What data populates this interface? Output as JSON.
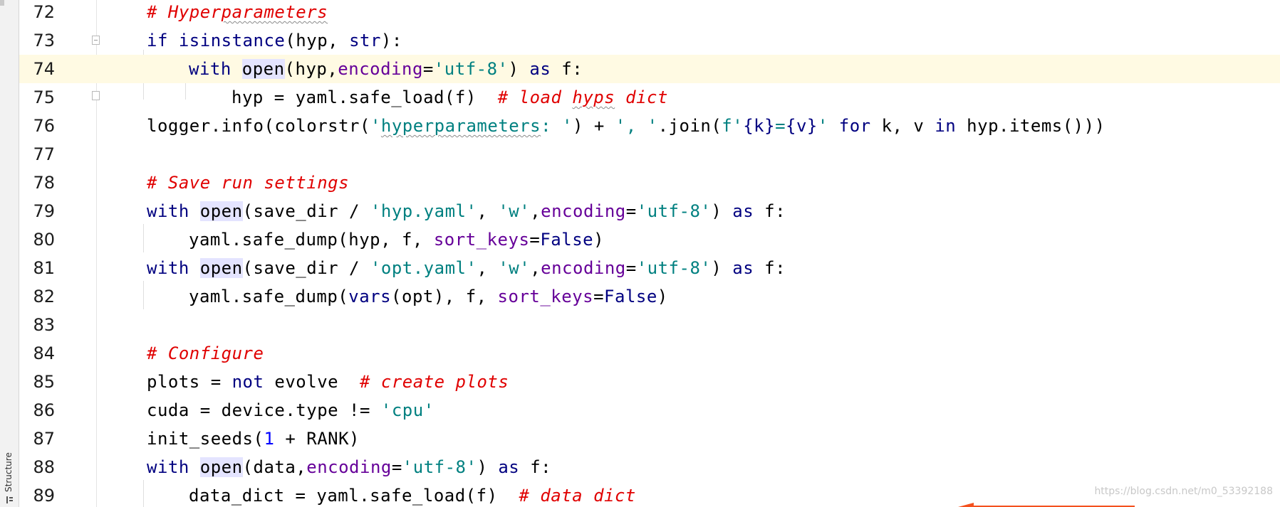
{
  "sidebar": {
    "structure_tab_label": "Structure",
    "structure_icon": "structure-icon"
  },
  "watermark": "https://blog.csdn.net/m0_53392188",
  "colors": {
    "keyword": "#000080",
    "string": "#008080",
    "comment": "#e00000",
    "param": "#660099",
    "number": "#0000ff",
    "current_line": "#fffae3",
    "identifier_highlight": "#e4e4ff",
    "annotation_arrow": "#f4511e"
  },
  "editor": {
    "current_line": "74",
    "lines": [
      {
        "num": "72"
      },
      {
        "num": "73"
      },
      {
        "num": "74"
      },
      {
        "num": "75"
      },
      {
        "num": "76"
      },
      {
        "num": "77"
      },
      {
        "num": "78"
      },
      {
        "num": "79"
      },
      {
        "num": "80"
      },
      {
        "num": "81"
      },
      {
        "num": "82"
      },
      {
        "num": "83"
      },
      {
        "num": "84"
      },
      {
        "num": "85"
      },
      {
        "num": "86"
      },
      {
        "num": "87"
      },
      {
        "num": "88"
      },
      {
        "num": "89"
      }
    ],
    "tokens": {
      "l72": {
        "c1": "# Hyper",
        "c2": "parameters"
      },
      "l73": {
        "a": "if ",
        "b": "isinstance",
        "c": "(hyp, ",
        "d": "str",
        "e": "):"
      },
      "l74": {
        "a": "with ",
        "b": "open",
        "c": "(hyp,",
        "d": "encoding",
        "e": "=",
        "f": "'utf-8'",
        "g": ") ",
        "h": "as",
        "i": " f:"
      },
      "l75": {
        "a": "hyp = yaml.safe_load(f)  ",
        "b": "# load ",
        "c": "hyps",
        "d": " dict"
      },
      "l76": {
        "a": "logger.info(colorstr(",
        "b": "'",
        "c": "hyperparameters",
        "d": ": '",
        "e": ") + ",
        "f": "', '",
        "g": ".join(",
        "h": "f'",
        "i": "{k}",
        "j": "=",
        "k": "{v}",
        "l": "'",
        "m": " for",
        "n": " k, v ",
        "o": "in",
        "p": " hyp.items()))"
      },
      "l78": {
        "a": "# Save run settings"
      },
      "l79": {
        "a": "with ",
        "b": "open",
        "c": "(save_dir / ",
        "d": "'hyp.yaml'",
        "e": ", ",
        "f": "'w'",
        "g": ",",
        "h": "encoding",
        "i": "=",
        "j": "'utf-8'",
        "k": ") ",
        "l": "as",
        "m": " f:"
      },
      "l80": {
        "a": "yaml.safe_dump(hyp, f, ",
        "b": "sort_keys",
        "c": "=",
        "d": "False",
        "e": ")"
      },
      "l81": {
        "a": "with ",
        "b": "open",
        "c": "(save_dir / ",
        "d": "'opt.yaml'",
        "e": ", ",
        "f": "'w'",
        "g": ",",
        "h": "encoding",
        "i": "=",
        "j": "'utf-8'",
        "k": ") ",
        "l": "as",
        "m": " f:"
      },
      "l82": {
        "a": "yaml.safe_dump(",
        "b": "vars",
        "c": "(opt), f, ",
        "d": "sort_keys",
        "e": "=",
        "f": "False",
        "g": ")"
      },
      "l84": {
        "a": "# Configure"
      },
      "l85": {
        "a": "plots = ",
        "b": "not",
        "c": " evolve  ",
        "d": "# create plots"
      },
      "l86": {
        "a": "cuda = device.type != ",
        "b": "'cpu'"
      },
      "l87": {
        "a": "init_seeds(",
        "b": "1",
        "c": " + RANK)"
      },
      "l88": {
        "a": "with ",
        "b": "open",
        "c": "(data,",
        "d": "encoding",
        "e": "=",
        "f": "'utf-8'",
        "g": ") ",
        "h": "as",
        "i": " f:"
      },
      "l89": {
        "a": "data_dict = yaml.safe_load(f)  ",
        "b": "# data dict"
      }
    }
  }
}
